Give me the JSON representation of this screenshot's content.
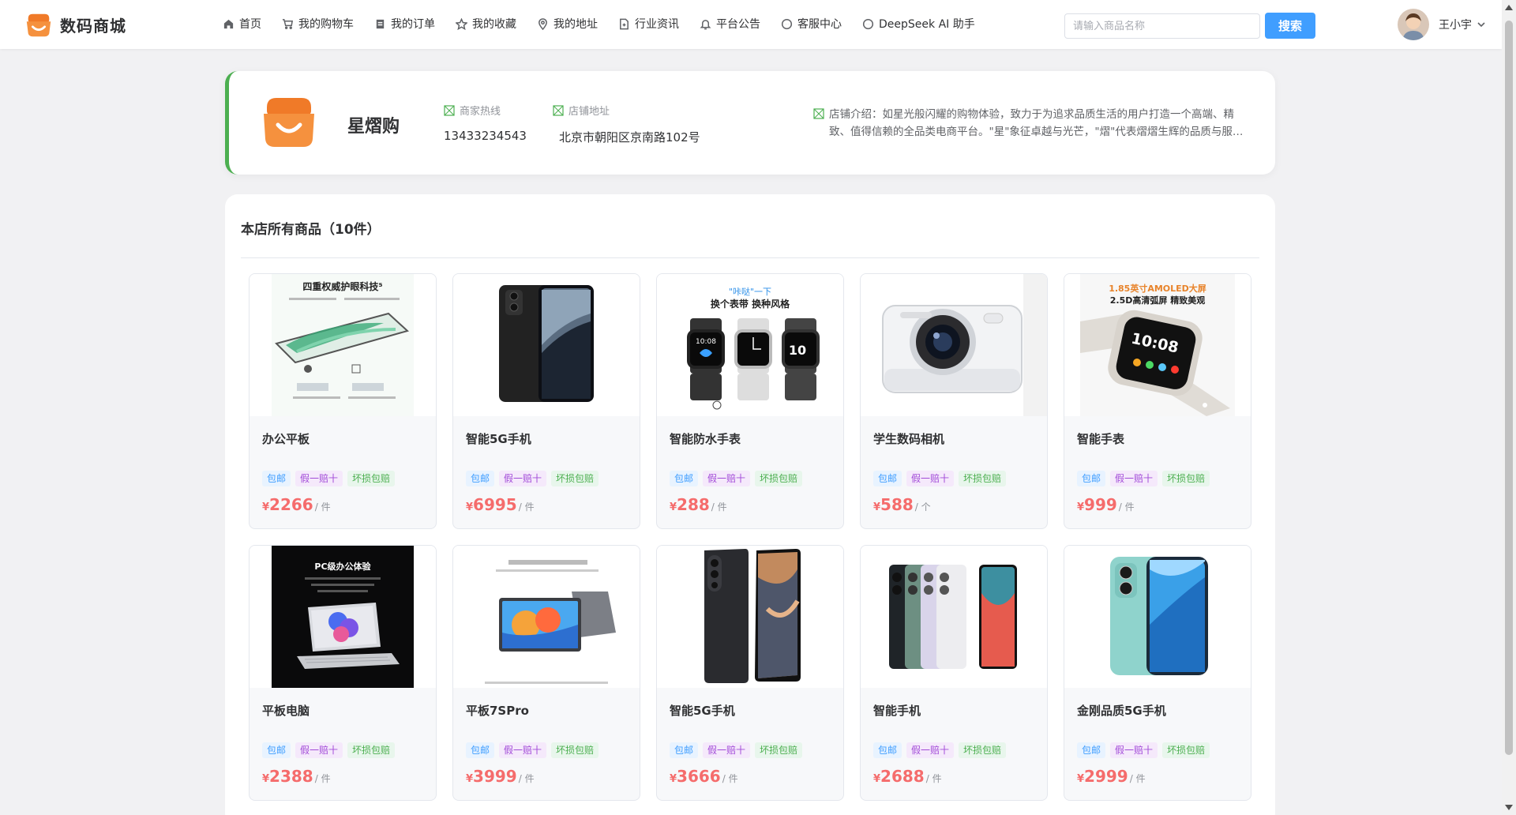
{
  "header": {
    "brand": "数码商城",
    "nav": [
      {
        "label": "首页",
        "icon": "home-icon"
      },
      {
        "label": "我的购物车",
        "icon": "cart-icon"
      },
      {
        "label": "我的订单",
        "icon": "order-icon"
      },
      {
        "label": "我的收藏",
        "icon": "star-icon"
      },
      {
        "label": "我的地址",
        "icon": "location-icon"
      },
      {
        "label": "行业资讯",
        "icon": "document-icon"
      },
      {
        "label": "平台公告",
        "icon": "bell-icon"
      },
      {
        "label": "客服中心",
        "icon": "chat-icon"
      },
      {
        "label": "DeepSeek AI 助手",
        "icon": "chat-icon"
      }
    ],
    "search_placeholder": "请输入商品名称",
    "search_button": "搜索",
    "user_name": "王小宇"
  },
  "store": {
    "name": "星熠购",
    "hotline_label": "商家热线",
    "hotline": "13433234543",
    "address_label": "店铺地址",
    "address": "北京市朝阳区京南路102号",
    "intro_label": "店铺介绍：",
    "intro": "如星光般闪耀的购物体验，致力于为追求品质生活的用户打造一个高端、精致、值得信赖的全品类电商平台。\"星\"象征卓越与光芒，\"熠\"代表熠熠生辉的品质与服务。"
  },
  "products_section": {
    "title": "本店所有商品（10件）"
  },
  "tags": [
    "包邮",
    "假一赔十",
    "坏损包赔"
  ],
  "currency": "¥",
  "products": [
    {
      "name": "办公平板",
      "price": "2266",
      "unit": "/ 件",
      "image": "tablet-image"
    },
    {
      "name": "智能5G手机",
      "price": "6995",
      "unit": "/ 件",
      "image": "phone-image"
    },
    {
      "name": "智能防水手表",
      "price": "288",
      "unit": "/ 件",
      "image": "watch-set-image"
    },
    {
      "name": "学生数码相机",
      "price": "588",
      "unit": "/ 个",
      "image": "camera-image"
    },
    {
      "name": "智能手表",
      "price": "999",
      "unit": "/ 件",
      "image": "watch-image"
    },
    {
      "name": "平板电脑",
      "price": "2388",
      "unit": "/ 件",
      "image": "tablet-keyboard-image"
    },
    {
      "name": "平板7SPro",
      "price": "3999",
      "unit": "/ 件",
      "image": "tablet-image"
    },
    {
      "name": "智能5G手机",
      "price": "3666",
      "unit": "/ 件",
      "image": "phone-image"
    },
    {
      "name": "智能手机",
      "price": "2688",
      "unit": "/ 件",
      "image": "phone-colors-image"
    },
    {
      "name": "金刚品质5G手机",
      "price": "2999",
      "unit": "/ 件",
      "image": "phone-teal-image"
    }
  ],
  "image_text": {
    "p1_headline": "四重权威护眼科技⁵",
    "p3_line1": "\"咔哒\"一下",
    "p3_line2": "换个表带  换种风格",
    "p3_time1": "10:08",
    "p3_time2": "10",
    "p5_line1": "1.85英寸AMOLED大屏",
    "p5_line2": "2.5D高清弧屏  精致美观",
    "p5_time": "10:08",
    "p6_headline": "PC级办公体验"
  },
  "colors": {
    "accent": "#409eff",
    "price": "#f56c6c",
    "store_border": "#4caf50",
    "brand_orange": "#f07a28"
  }
}
